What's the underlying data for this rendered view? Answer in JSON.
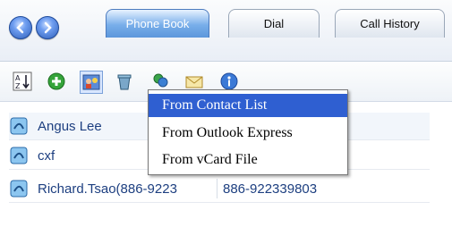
{
  "tabs": [
    {
      "label": "Phone Book",
      "active": true
    },
    {
      "label": "Dial",
      "active": false
    },
    {
      "label": "Call History",
      "active": false
    }
  ],
  "toolbar": {
    "icons": [
      "sort-icon",
      "add-contact-icon",
      "import-contacts-icon",
      "delete-contact-icon",
      "group-contacts-icon",
      "email-icon",
      "info-icon"
    ]
  },
  "contacts": [
    {
      "name": "Angus Lee",
      "phone": ""
    },
    {
      "name": "cxf",
      "phone": ""
    },
    {
      "name": "Richard.Tsao(886-9223",
      "phone": "886-922339803"
    }
  ],
  "import_menu": {
    "items": [
      {
        "label": "From Contact List",
        "highlighted": true
      },
      {
        "label": "From Outlook Express",
        "highlighted": false
      },
      {
        "label": "From vCard File",
        "highlighted": false
      }
    ]
  },
  "colors": {
    "accent": "#2f5fd1",
    "tab_active": "#5c97db",
    "link_text": "#1d3f80"
  }
}
